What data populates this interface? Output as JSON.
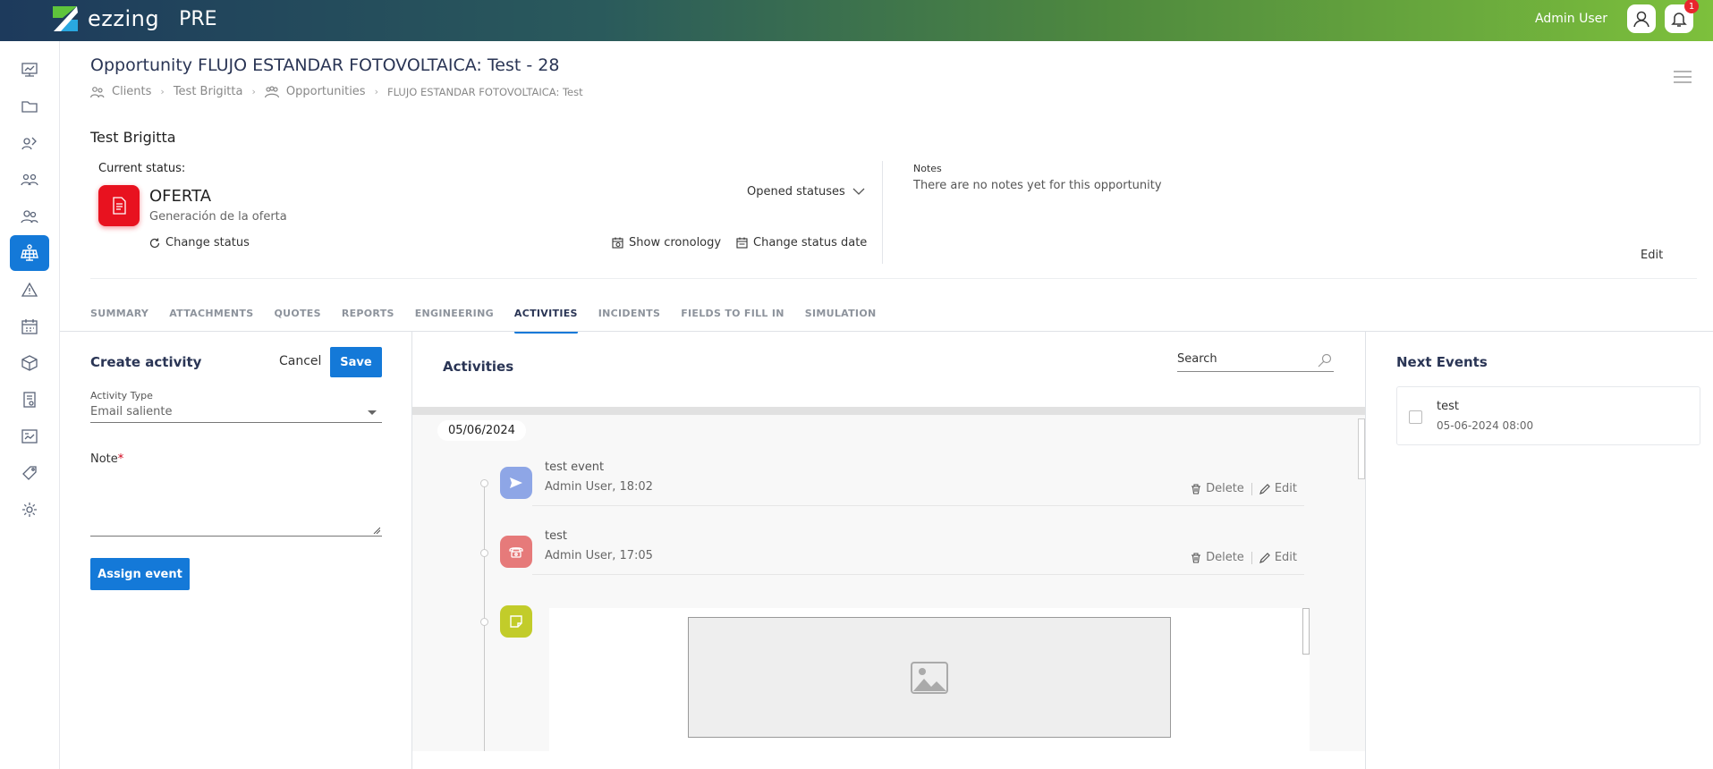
{
  "app": {
    "brand": "ezzing",
    "env": "PRE"
  },
  "topbar": {
    "user_name": "Admin User",
    "notifications_count": "1"
  },
  "sidebar": {
    "items": [
      {
        "icon": "dashboard-icon"
      },
      {
        "icon": "folder-icon"
      },
      {
        "icon": "leads-icon"
      },
      {
        "icon": "opportunities-icon"
      },
      {
        "icon": "clients-icon"
      },
      {
        "icon": "solar-panel-icon",
        "active": true
      },
      {
        "icon": "warning-icon"
      },
      {
        "icon": "calendar-icon"
      },
      {
        "icon": "box-icon"
      },
      {
        "icon": "billing-icon"
      },
      {
        "icon": "reports-icon"
      },
      {
        "icon": "tag-icon"
      },
      {
        "icon": "settings-icon"
      }
    ]
  },
  "header": {
    "title": "Opportunity FLUJO ESTANDAR FOTOVOLTAICA: Test - 28",
    "breadcrumb": [
      "Clients",
      "Test Brigitta",
      "Opportunities",
      "FLUJO ESTANDAR FOTOVOLTAICA: Test"
    ]
  },
  "client": {
    "name": "Test Brigitta"
  },
  "status": {
    "label": "Current status:",
    "name": "OFERTA",
    "subtitle": "Generación de la oferta",
    "change_status": "Change status",
    "opened_statuses": "Opened statuses",
    "show_cronology": "Show cronology",
    "change_status_date": "Change status date",
    "color": "#e8121f"
  },
  "notes": {
    "label": "Notes",
    "text": "There are no notes yet for this opportunity",
    "edit": "Edit"
  },
  "tabs": [
    {
      "label": "SUMMARY"
    },
    {
      "label": "ATTACHMENTS"
    },
    {
      "label": "QUOTES"
    },
    {
      "label": "REPORTS"
    },
    {
      "label": "ENGINEERING"
    },
    {
      "label": "ACTIVITIES",
      "active": true
    },
    {
      "label": "INCIDENTS"
    },
    {
      "label": "FIELDS TO FILL IN"
    },
    {
      "label": "SIMULATION"
    }
  ],
  "create_activity": {
    "title": "Create activity",
    "cancel": "Cancel",
    "save": "Save",
    "type_label": "Activity Type",
    "type_value": "Email saliente",
    "note_label": "Note",
    "required_mark": "*",
    "assign": "Assign event"
  },
  "activities": {
    "title": "Activities",
    "search_placeholder": "Search",
    "date": "05/06/2024",
    "items": [
      {
        "name": "test event",
        "meta": "Admin User, 18:02",
        "icon": "send-icon",
        "color": "#8ea6e6",
        "delete": "Delete",
        "edit": "Edit"
      },
      {
        "name": "test",
        "meta": "Admin User, 17:05",
        "icon": "phone-icon",
        "color": "#e67a7a",
        "delete": "Delete",
        "edit": "Edit"
      },
      {
        "icon": "note-icon",
        "color": "#c2cc2a"
      }
    ]
  },
  "next_events": {
    "title": "Next Events",
    "items": [
      {
        "name": "test",
        "date": "05-06-2024 08:00"
      }
    ]
  },
  "colors": {
    "accent": "#1479d8",
    "title": "#2a3555"
  }
}
